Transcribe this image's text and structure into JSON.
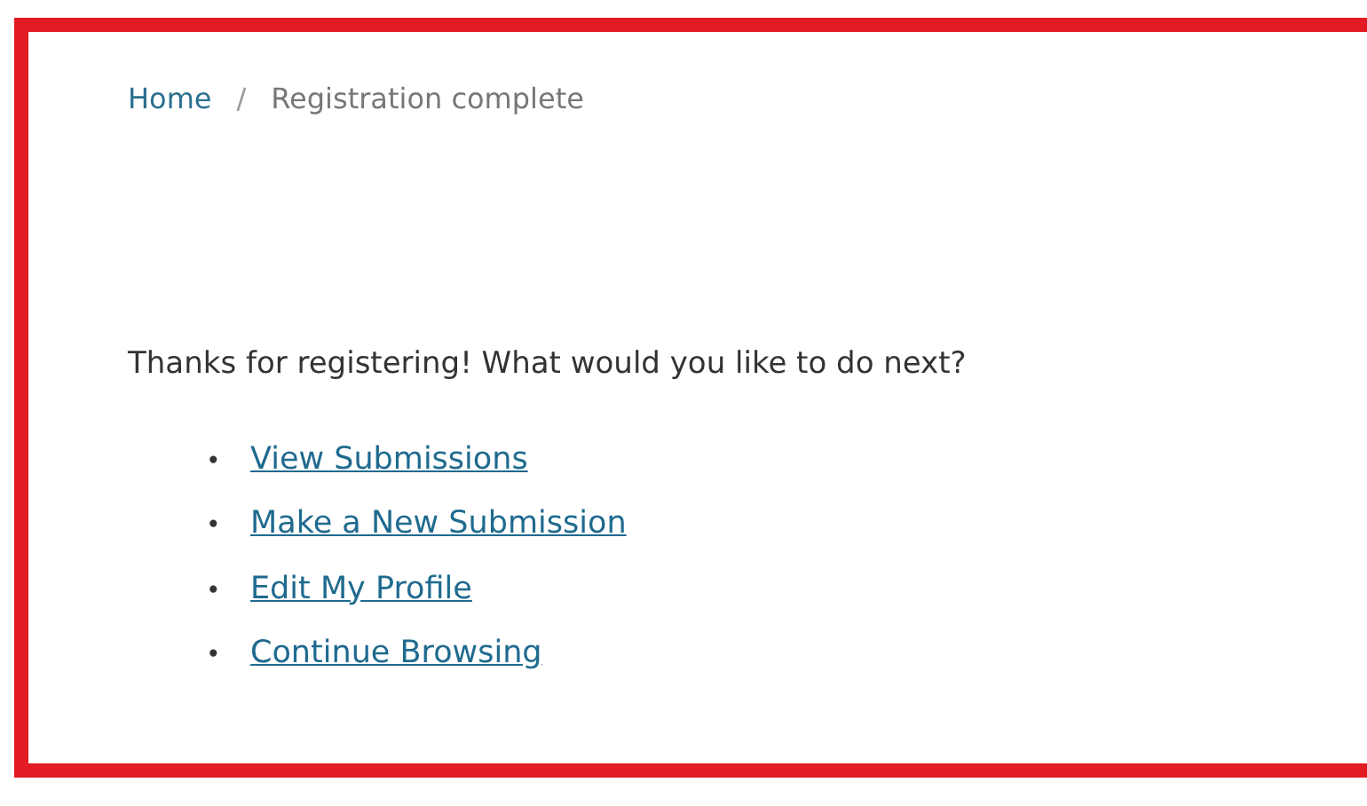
{
  "breadcrumb": [
    {
      "label": "Home",
      "kind": "link"
    },
    {
      "label": "Registration complete",
      "kind": "current"
    }
  ],
  "breadcrumb_separator": "/",
  "message": "Thanks for registering! What would you like to do next?",
  "links": [
    "View Submissions",
    "Make a New Submission",
    "Edit My Profile",
    "Continue Browsing"
  ],
  "bullet": "•"
}
